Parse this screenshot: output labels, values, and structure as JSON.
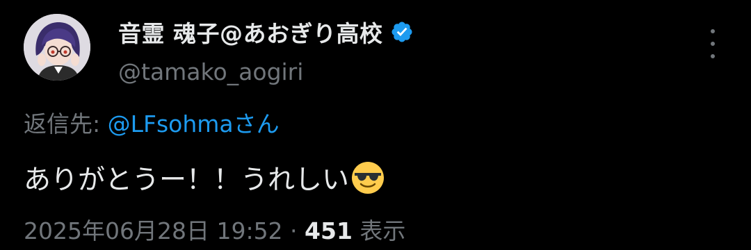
{
  "author": {
    "display_name": "音霊 魂子@あおぎり高校",
    "handle": "@tamako_aogiri",
    "verified": true,
    "verified_badge_color": "#1d9bf0"
  },
  "reply": {
    "prefix": "返信先: ",
    "to": "@LFsohmaさん"
  },
  "tweet": {
    "text": "ありがとうー！！うれしい",
    "emoji": "smiling-face-with-sunglasses"
  },
  "meta": {
    "timestamp": "2025年06月28日 19:52",
    "separator": " · ",
    "views_count": "451",
    "views_label": " 表示"
  },
  "colors": {
    "background": "#000000",
    "primary_text": "#e7e9ea",
    "secondary_text": "#71767b",
    "link": "#1d9bf0"
  }
}
